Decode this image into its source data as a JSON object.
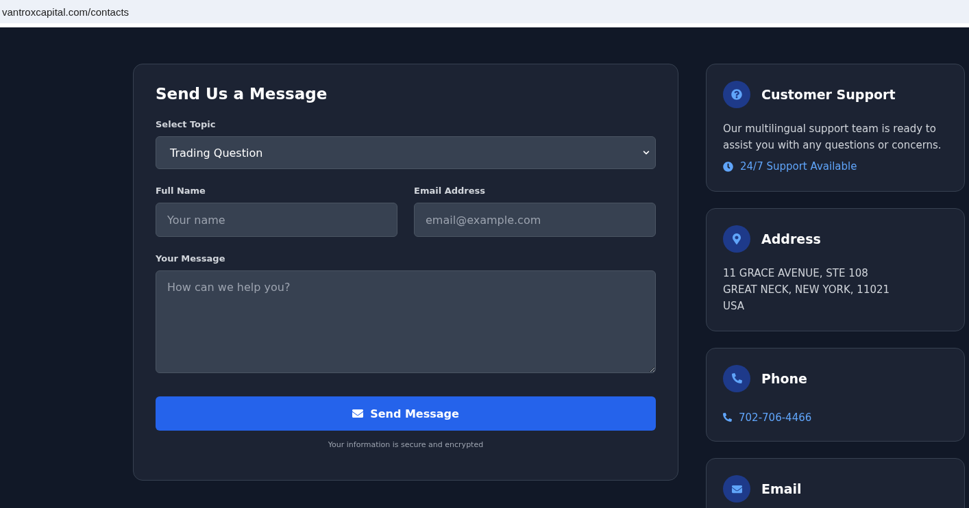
{
  "address_bar": {
    "url": "vantroxcapital.com/contacts"
  },
  "form": {
    "title": "Send Us a Message",
    "topic": {
      "label": "Select Topic",
      "value": "Trading Question"
    },
    "name": {
      "label": "Full Name",
      "placeholder": "Your name"
    },
    "email": {
      "label": "Email Address",
      "placeholder": "email@example.com"
    },
    "message": {
      "label": "Your Message",
      "placeholder": "How can we help you?"
    },
    "submit": "Send Message",
    "note": "Your information is secure and encrypted"
  },
  "cards": [
    {
      "kind": "question",
      "title": "Customer Support",
      "lines": [
        {
          "kind": "text",
          "text": "Our multilingual support team is ready to assist you with any questions or concerns."
        },
        {
          "kind": "clock-link",
          "text": "24/7 Support Available"
        }
      ]
    },
    {
      "kind": "pin",
      "title": "Address",
      "lines": [
        {
          "kind": "text",
          "text": "11 GRACE AVENUE, STE 108"
        },
        {
          "kind": "text",
          "text": "GREAT NECK, NEW YORK, 11021"
        },
        {
          "kind": "text",
          "text": "USA"
        }
      ]
    },
    {
      "kind": "phone",
      "title": "Phone",
      "lines": [
        {
          "kind": "phone-link",
          "text": "702-706-4466"
        }
      ]
    },
    {
      "kind": "mail",
      "title": "Email"
    }
  ]
}
